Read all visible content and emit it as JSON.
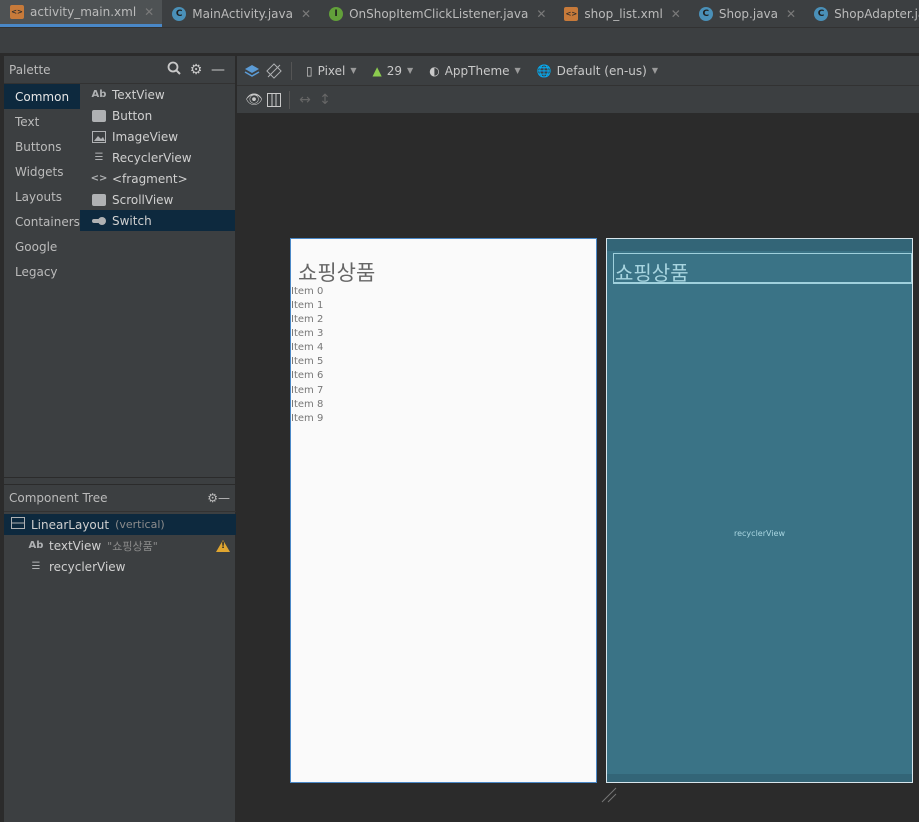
{
  "tabs": [
    {
      "label": "activity_main.xml",
      "kind": "xml",
      "active": true
    },
    {
      "label": "MainActivity.java",
      "kind": "class"
    },
    {
      "label": "OnShopItemClickListener.java",
      "kind": "interface"
    },
    {
      "label": "shop_list.xml",
      "kind": "xml"
    },
    {
      "label": "Shop.java",
      "kind": "class"
    },
    {
      "label": "ShopAdapter.java",
      "kind": "class"
    }
  ],
  "palette": {
    "title": "Palette",
    "categories": [
      "Common",
      "Text",
      "Buttons",
      "Widgets",
      "Layouts",
      "Containers",
      "Google",
      "Legacy"
    ],
    "widgets": [
      {
        "label": "TextView",
        "icon": "Ab"
      },
      {
        "label": "Button",
        "icon": "button-icon"
      },
      {
        "label": "ImageView",
        "icon": "image-icon"
      },
      {
        "label": "RecyclerView",
        "icon": "list-icon"
      },
      {
        "label": "<fragment>",
        "icon": "code-icon"
      },
      {
        "label": "ScrollView",
        "icon": "scroll-icon"
      },
      {
        "label": "Switch",
        "icon": "switch-icon"
      }
    ]
  },
  "component_tree": {
    "title": "Component Tree",
    "root": {
      "label": "LinearLayout",
      "hint": "(vertical)"
    },
    "children": [
      {
        "label": "textView",
        "hint": "\"쇼핑상품\"",
        "icon": "Ab",
        "warning": true
      },
      {
        "label": "recyclerView",
        "icon": "list-icon"
      }
    ]
  },
  "toolbar": {
    "device": "Pixel",
    "api": "29",
    "theme": "AppTheme",
    "locale": "Default (en-us)"
  },
  "preview": {
    "title": "쇼핑상품",
    "items": [
      "Item 0",
      "Item 1",
      "Item 2",
      "Item 3",
      "Item 4",
      "Item 5",
      "Item 6",
      "Item 7",
      "Item 8",
      "Item 9"
    ]
  },
  "blueprint": {
    "title": "쇼핑상품",
    "recycler_label": "recyclerView"
  },
  "colors": {
    "accent": "#4a88c7",
    "selection": "#0d293e",
    "blueprint": "#3a7386",
    "warning": "#e0a630"
  }
}
